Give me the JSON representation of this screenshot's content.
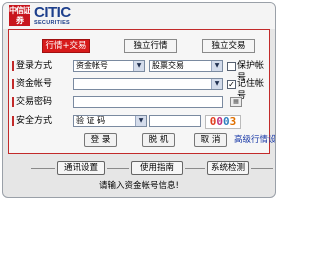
{
  "brand": {
    "logo_text": "中信证券",
    "name": "CITIC",
    "subtitle": "SECURITIES"
  },
  "tabs": [
    {
      "label": "行情+交易",
      "active": true
    },
    {
      "label": "独立行情",
      "active": false
    },
    {
      "label": "独立交易",
      "active": false
    }
  ],
  "form": {
    "login_method_label": "登录方式",
    "login_method_value": "资金帐号",
    "login_type_value": "股票交易",
    "protect_account_label": "保护帐号",
    "protect_account_checked": false,
    "account_label": "资金帐号",
    "account_value": "",
    "remember_account_label": "记住帐号",
    "remember_account_checked": true,
    "password_label": "交易密码",
    "password_value": "",
    "security_label": "安全方式",
    "security_value": "验 证 码",
    "captcha_input_value": "",
    "captcha_text": "0003"
  },
  "buttons": {
    "login": "登 录",
    "offline": "脱 机",
    "cancel": "取 消"
  },
  "advanced_link": "高级行情设置",
  "bottom": {
    "comm_settings": "通讯设置",
    "guide": "使用指南",
    "system_check": "系统检测"
  },
  "status_text": "请输入资金帐号信息!",
  "colors": {
    "accent_red": "#d71a1a",
    "brand_blue": "#1d3f8c",
    "link_blue": "#1a3aa8"
  }
}
